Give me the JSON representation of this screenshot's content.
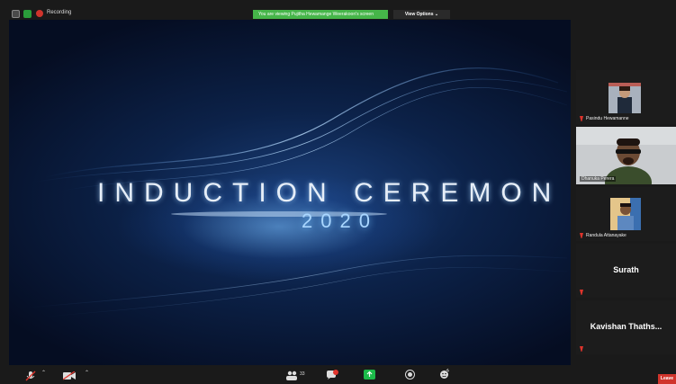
{
  "topbar": {
    "recording_label": "Recording",
    "share_banner": "You are viewing Pujitha Hewamange Weerakoon's screen",
    "view_options": "View Options ⌄"
  },
  "screen": {
    "title_line1": "INDUCTION CEREMON",
    "title_line2": "2020"
  },
  "participants": [
    {
      "name": "Pasindu Hewamanne",
      "muted": true,
      "has_video": true
    },
    {
      "name": "Dhanuka Perera",
      "muted": false,
      "has_video": true,
      "active": true
    },
    {
      "name": "Randula Attanayake",
      "muted": true,
      "has_video": true
    },
    {
      "name": "Surath",
      "muted": true,
      "has_video": false
    },
    {
      "name": "Kavishan  Thaths...",
      "muted": true,
      "has_video": false
    }
  ],
  "toolbar": {
    "participants_count": "33",
    "leave_label": "Leave"
  },
  "colors": {
    "green_banner": "#46b549",
    "active_speaker": "#b8e04a",
    "leave": "#d0342c"
  }
}
